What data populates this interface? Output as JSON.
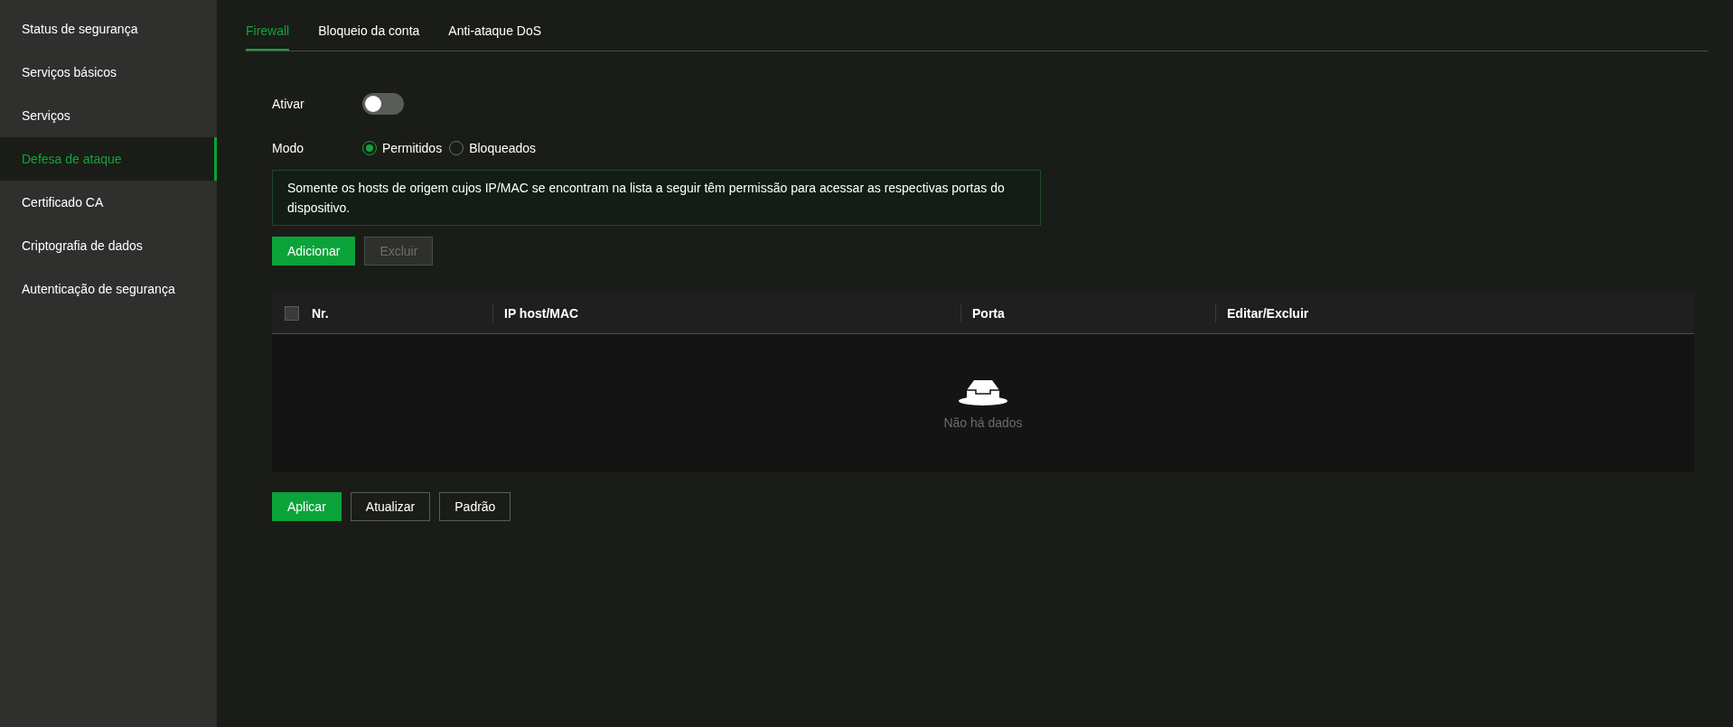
{
  "sidebar": {
    "items": [
      {
        "label": "Status de segurança",
        "selected": false
      },
      {
        "label": "Serviços básicos",
        "selected": false
      },
      {
        "label": "Serviços",
        "selected": false
      },
      {
        "label": "Defesa de ataque",
        "selected": true
      },
      {
        "label": "Certificado CA",
        "selected": false
      },
      {
        "label": "Criptografia de dados",
        "selected": false
      },
      {
        "label": "Autenticação de segurança",
        "selected": false
      }
    ]
  },
  "tabs": [
    {
      "label": "Firewall",
      "selected": true
    },
    {
      "label": "Bloqueio da conta",
      "selected": false
    },
    {
      "label": "Anti-ataque DoS",
      "selected": false
    }
  ],
  "enable": {
    "label": "Ativar",
    "on": false
  },
  "mode": {
    "label": "Modo",
    "options": [
      {
        "label": "Permitidos",
        "selected": true
      },
      {
        "label": "Bloqueados",
        "selected": false
      }
    ]
  },
  "info": "Somente os hosts de origem cujos IP/MAC se encontram na lista a seguir têm permissão para acessar as respectivas portas do dispositivo.",
  "actions": [
    {
      "label": "Adicionar",
      "disabled": false,
      "primary": true
    },
    {
      "label": "Excluir",
      "disabled": true,
      "primary": false
    }
  ],
  "table": {
    "select_all": {
      "checked": false
    },
    "columns": [
      "Nr.",
      "IP host/MAC",
      "Porta",
      "Editar/Excluir"
    ],
    "empty_text": "Não há dados"
  },
  "footer_buttons": [
    {
      "label": "Aplicar",
      "primary": true
    },
    {
      "label": "Atualizar",
      "primary": false
    },
    {
      "label": "Padrão",
      "primary": false
    }
  ]
}
